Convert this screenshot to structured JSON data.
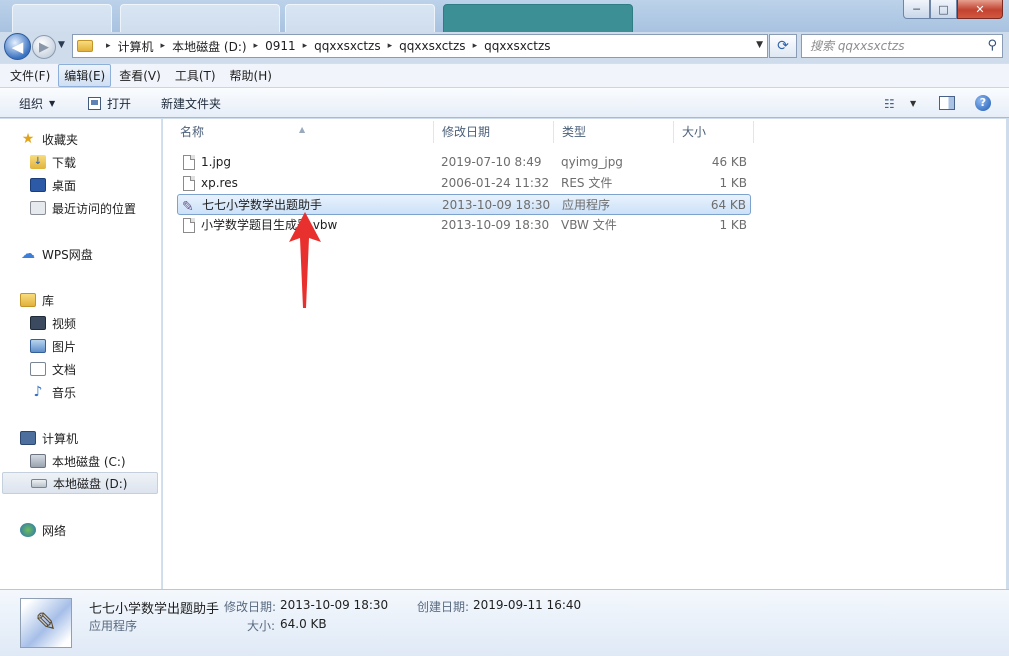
{
  "window": {
    "minimize_glyph": "─",
    "maximize_glyph": "□",
    "close_glyph": "✕"
  },
  "address_bar": {
    "crumbs": [
      "计算机",
      "本地磁盘 (D:)",
      "0911",
      "qqxxsxctzs",
      "qqxxsxctzs",
      "qqxxsxctzs"
    ],
    "separator": "▸"
  },
  "search": {
    "placeholder": "搜索 qqxxsxctzs"
  },
  "menubar": {
    "items": [
      "文件(F)",
      "编辑(E)",
      "查看(V)",
      "工具(T)",
      "帮助(H)"
    ]
  },
  "toolbar": {
    "organize_label": "组织",
    "open_label": "打开",
    "new_folder_label": "新建文件夹"
  },
  "sidebar": {
    "favorites_label": "收藏夹",
    "downloads_label": "下载",
    "desktop_label": "桌面",
    "recent_label": "最近访问的位置",
    "wps_label": "WPS网盘",
    "library_label": "库",
    "videos_label": "视频",
    "pictures_label": "图片",
    "documents_label": "文档",
    "music_label": "音乐",
    "computer_label": "计算机",
    "drive_c_label": "本地磁盘 (C:)",
    "drive_d_label": "本地磁盘 (D:)",
    "network_label": "网络"
  },
  "columns": {
    "name": "名称",
    "date": "修改日期",
    "type": "类型",
    "size": "大小"
  },
  "files": [
    {
      "name": "1.jpg",
      "date": "2019-07-10 8:49",
      "type": "qyimg_jpg",
      "size": "46 KB"
    },
    {
      "name": "xp.res",
      "date": "2006-01-24 11:32",
      "type": "RES 文件",
      "size": "1 KB"
    },
    {
      "name": "七七小学数学出题助手",
      "date": "2013-10-09 18:30",
      "type": "应用程序",
      "size": "64 KB"
    },
    {
      "name": "小学数学题目生成器.vbw",
      "date": "2013-10-09 18:30",
      "type": "VBW 文件",
      "size": "1 KB"
    }
  ],
  "details": {
    "file_name": "七七小学数学出题助手",
    "file_type": "应用程序",
    "modified_label": "修改日期:",
    "modified_value": "2013-10-09 18:30",
    "created_label": "创建日期:",
    "created_value": "2019-09-11 16:40",
    "size_label": "大小:",
    "size_value": "64.0 KB"
  },
  "colors": {
    "selection": "#cce1f8",
    "accent_arrow": "#e8312f"
  }
}
